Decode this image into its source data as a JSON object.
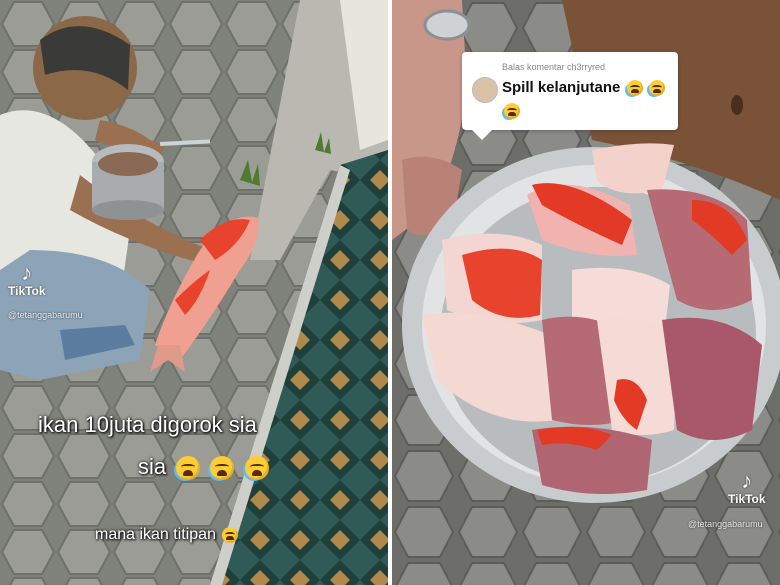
{
  "left_panel": {
    "caption_line1": "ikan 10juta digorok sia",
    "caption_line2": "sia",
    "caption_line2_emoji_count": 3,
    "subcaption": "mana ikan titipan",
    "tiktok_brand": "TikTok",
    "tiktok_handle": "@tetanggabarumu",
    "colors": {
      "caption_text": "#ffffff",
      "fish_red": "#e8432c",
      "tile": "#8f908a"
    }
  },
  "right_panel": {
    "comment_header": "Balas komentar ch3rryred",
    "comment_text": "Spill kelanjutane",
    "tiktok_brand": "TikTok",
    "tiktok_handle": "@tetanggabarumu",
    "colors": {
      "pot": "#c9ccce",
      "fish_red": "#e23a25",
      "meat": "#b56a74"
    }
  },
  "icons": [
    "tiktok-logo-icon",
    "crying-laughing-emoji-icon",
    "pleading-face-emoji-icon",
    "commenter-avatar-icon"
  ]
}
